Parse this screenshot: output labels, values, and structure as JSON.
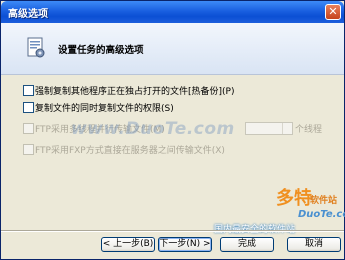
{
  "window": {
    "title": "高级选项"
  },
  "header": {
    "title": "设置任务的高级选项"
  },
  "options": [
    {
      "label": "强制复制其他程序正在独占打开的文件[热备份](P)",
      "enabled": true,
      "checked": false
    },
    {
      "label": "复制文件的同时复制文件的权限(S)",
      "enabled": true,
      "checked": false
    },
    {
      "label": "FTP采用多线程并行传输文件(M)",
      "enabled": false,
      "checked": false,
      "suffix": "个线程"
    },
    {
      "label": "FTP采用FXP方式直接在服务器之间传输文件(X)",
      "enabled": false,
      "checked": false
    }
  ],
  "watermark": {
    "text": "www.DuoTe.com",
    "brand": "多特",
    "brand_sub": "软件站",
    "site": "DuoTe.com",
    "slogan": "国内最安全的软件站"
  },
  "buttons": {
    "back": "< 上一步(B)",
    "next": "下一步(N) >",
    "finish": "完成",
    "cancel": "取消"
  }
}
